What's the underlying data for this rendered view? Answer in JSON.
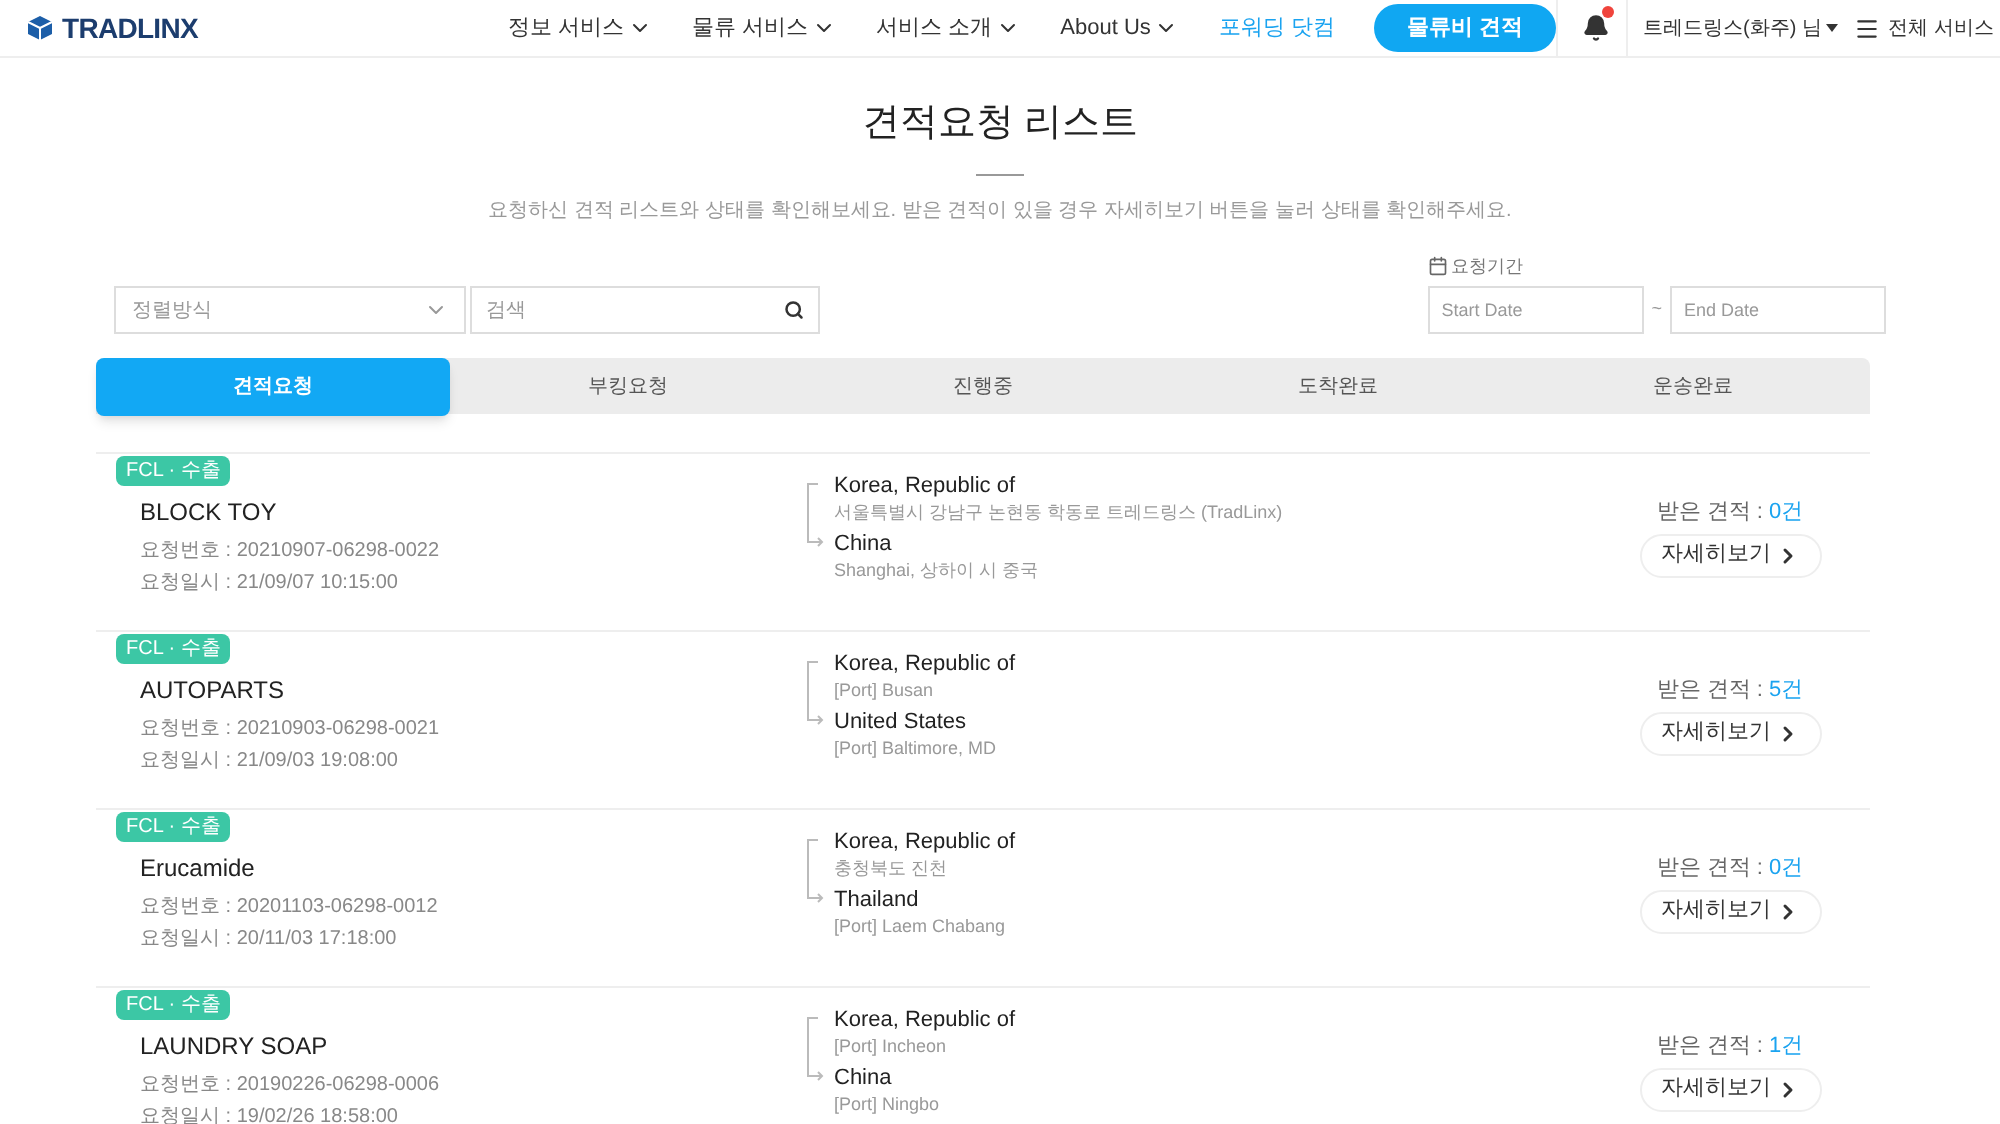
{
  "header": {
    "logo": "TRADLINX",
    "nav": [
      {
        "label": "정보 서비스",
        "kind": "menu"
      },
      {
        "label": "물류 서비스",
        "kind": "menu"
      },
      {
        "label": "서비스 소개",
        "kind": "menu"
      },
      {
        "label": "About Us",
        "kind": "menu"
      },
      {
        "label": "포워딩 닷컴",
        "kind": "highlight"
      },
      {
        "label": "물류비 견적",
        "kind": "button"
      }
    ],
    "notification": true,
    "user": "트레드링스(화주) 님",
    "all_services": "전체 서비스"
  },
  "page": {
    "title": "견적요청 리스트",
    "subtitle": "요청하신 견적 리스트와 상태를 확인해보세요. 받은 견적이 있을 경우 자세히보기 버튼을 눌러 상태를 확인해주세요."
  },
  "filters": {
    "sort": {
      "placeholder": "정렬방식"
    },
    "search": {
      "placeholder": "검색"
    },
    "period_label": "요청기간",
    "start": {
      "placeholder": "Start Date"
    },
    "separator": "~",
    "end": {
      "placeholder": "End Date"
    }
  },
  "tabs": [
    {
      "label": "견적요청",
      "selected": true
    },
    {
      "label": "부킹요청",
      "selected": false
    },
    {
      "label": "진행중",
      "selected": false
    },
    {
      "label": "도착완료",
      "selected": false
    },
    {
      "label": "운송완료",
      "selected": false
    }
  ],
  "requests": [
    {
      "tag": "FCL · 수출",
      "name": "BLOCK TOY",
      "number": "요청번호 : 20210907-06298-0022",
      "date": "요청일시 : 21/09/07 10:15:00",
      "origin": "Korea, Republic of",
      "origin_detail": "서울특별시 강남구 논현동 학동로 트레드링스 (TradLinx)",
      "destination": "China",
      "destination_detail": "Shanghai, 상하이 시 중국",
      "received_label": "받은 견적 : ",
      "received_count": "0건",
      "detail_button": "자세히보기"
    },
    {
      "tag": "FCL · 수출",
      "name": "AUTOPARTS",
      "number": "요청번호 : 20210903-06298-0021",
      "date": "요청일시 : 21/09/03 19:08:00",
      "origin": "Korea, Republic of",
      "origin_detail": "[Port] Busan",
      "destination": "United States",
      "destination_detail": "[Port] Baltimore, MD",
      "received_label": "받은 견적 : ",
      "received_count": "5건",
      "detail_button": "자세히보기"
    },
    {
      "tag": "FCL · 수출",
      "name": "Erucamide",
      "number": "요청번호 : 20201103-06298-0012",
      "date": "요청일시 : 20/11/03 17:18:00",
      "origin": "Korea, Republic of",
      "origin_detail": "충청북도 진천",
      "destination": "Thailand",
      "destination_detail": "[Port] Laem Chabang",
      "received_label": "받은 견적 : ",
      "received_count": "0건",
      "detail_button": "자세히보기"
    },
    {
      "tag": "FCL · 수출",
      "name": "LAUNDRY SOAP",
      "number": "요청번호 : 20190226-06298-0006",
      "date": "요청일시 : 19/02/26 18:58:00",
      "origin": "Korea, Republic of",
      "origin_detail": "[Port] Incheon",
      "destination": "China",
      "destination_detail": "[Port] Ningbo",
      "received_label": "받은 견적 : ",
      "received_count": "1건",
      "detail_button": "자세히보기"
    }
  ]
}
